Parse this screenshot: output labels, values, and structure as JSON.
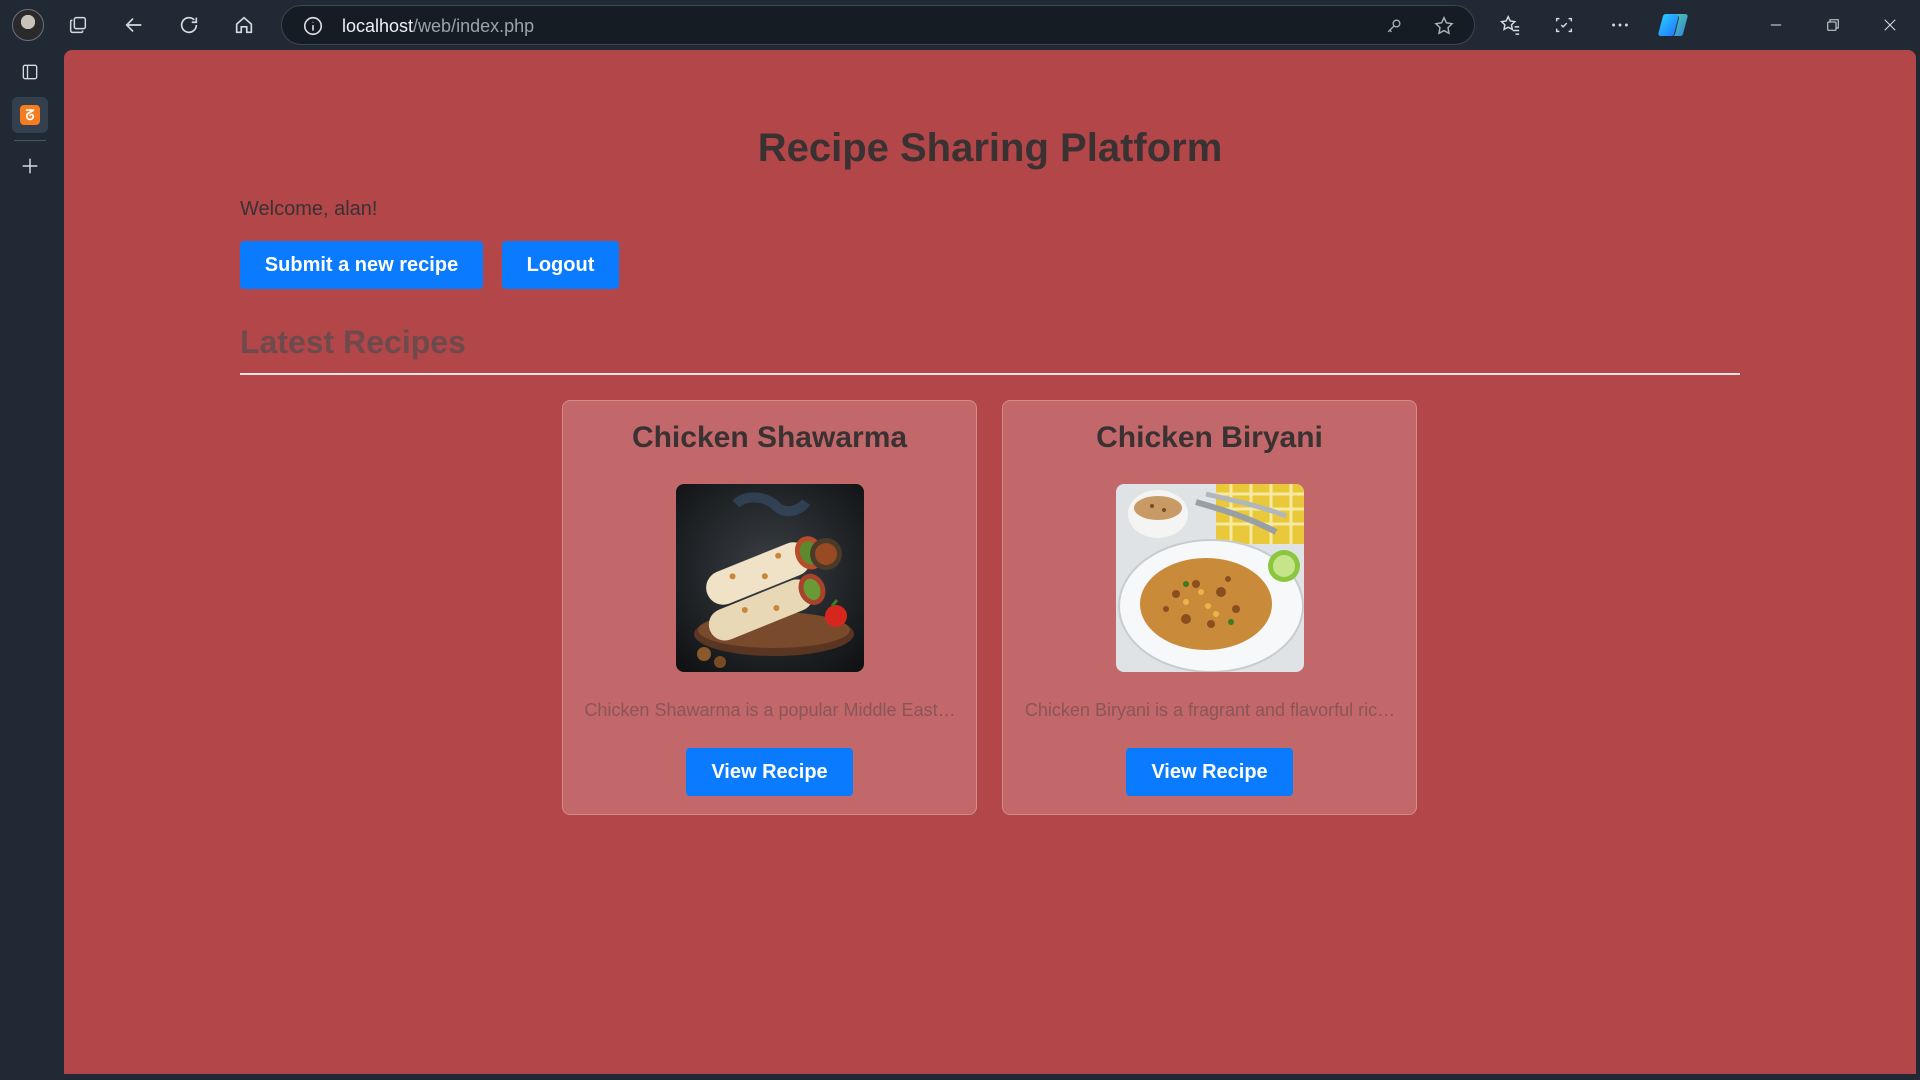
{
  "browser": {
    "url_host": "localhost",
    "url_path": "/web/index.php"
  },
  "page": {
    "title": "Recipe Sharing Platform",
    "welcome": "Welcome, alan!",
    "submit_label": "Submit a new recipe",
    "logout_label": "Logout",
    "section_title": "Latest Recipes"
  },
  "recipes": [
    {
      "title": "Chicken Shawarma",
      "description": "Chicken Shawarma is a popular Middle East…",
      "button_label": "View Recipe"
    },
    {
      "title": "Chicken Biryani",
      "description": "Chicken Biryani is a fragrant and flavorful ric…",
      "button_label": "View Recipe"
    }
  ],
  "colors": {
    "page_bg": "#b24648",
    "card_bg": "#c2686b",
    "primary_button": "#0a7bff",
    "chrome_bg": "#202934"
  },
  "icons": [
    "profile-avatar",
    "workspaces-icon",
    "back-icon",
    "refresh-icon",
    "home-icon",
    "site-info-icon",
    "password-key-icon",
    "favorite-star-icon",
    "favorites-icon",
    "screenshot-icon",
    "more-icon",
    "copilot-icon",
    "minimize-icon",
    "restore-icon",
    "close-icon",
    "tab-actions-icon",
    "xampp-tab-icon",
    "new-tab-icon"
  ]
}
